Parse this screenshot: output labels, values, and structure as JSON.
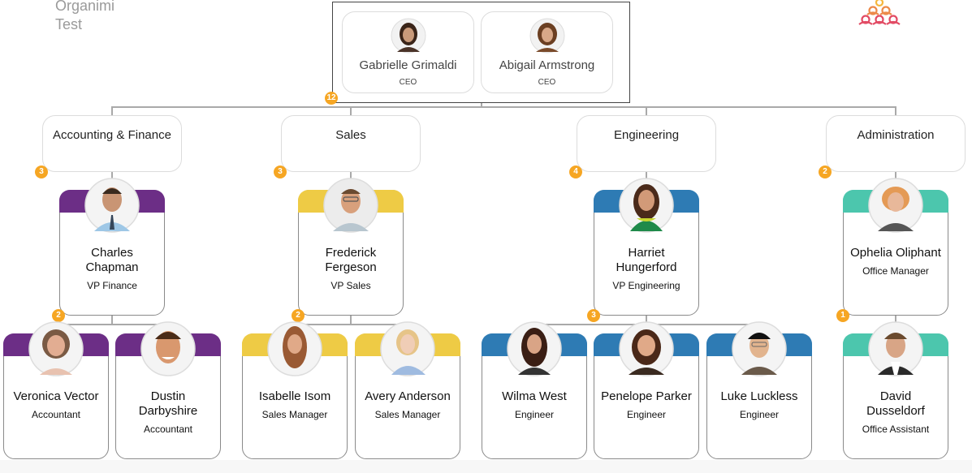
{
  "app": {
    "title_line1": "Organimi",
    "title_line2": "Test"
  },
  "colors": {
    "finance": "#6c2e86",
    "sales": "#eecb45",
    "engineering": "#2e7bb4",
    "administration": "#4cc6ad",
    "badge": "#f6a623",
    "connector": "#a9a9a9"
  },
  "root": {
    "badge": "12",
    "ceos": [
      {
        "name": "Gabrielle Grimaldi",
        "title": "CEO"
      },
      {
        "name": "Abigail Armstrong",
        "title": "CEO"
      }
    ]
  },
  "departments": [
    {
      "name": "Accounting & Finance",
      "badge": "3",
      "head": {
        "name_line1": "Charles",
        "name_line2": "Chapman",
        "title": "VP Finance",
        "badge": "2"
      },
      "members": [
        {
          "name_line1": "Veronica Vector",
          "name_line2": "",
          "title": "Accountant"
        },
        {
          "name_line1": "Dustin",
          "name_line2": "Darbyshire",
          "title": "Accountant"
        }
      ]
    },
    {
      "name": "Sales",
      "badge": "3",
      "head": {
        "name_line1": "Frederick",
        "name_line2": "Fergeson",
        "title": "VP Sales",
        "badge": "2"
      },
      "members": [
        {
          "name_line1": "Isabelle Isom",
          "name_line2": "",
          "title": "Sales Manager"
        },
        {
          "name_line1": "Avery Anderson",
          "name_line2": "",
          "title": "Sales Manager"
        }
      ]
    },
    {
      "name": "Engineering",
      "badge": "4",
      "head": {
        "name_line1": "Harriet",
        "name_line2": "Hungerford",
        "title": "VP Engineering",
        "badge": "3"
      },
      "members": [
        {
          "name_line1": "Wilma West",
          "name_line2": "",
          "title": "Engineer"
        },
        {
          "name_line1": "Penelope Parker",
          "name_line2": "",
          "title": "Engineer"
        },
        {
          "name_line1": "Luke Luckless",
          "name_line2": "",
          "title": "Engineer"
        }
      ]
    },
    {
      "name": "Administration",
      "badge": "2",
      "head": {
        "name_line1": "Ophelia Oliphant",
        "name_line2": "",
        "title": "Office Manager",
        "badge": "1"
      },
      "members": [
        {
          "name_line1": "David",
          "name_line2": "Dusseldorf",
          "title": "Office Assistant"
        }
      ]
    }
  ]
}
